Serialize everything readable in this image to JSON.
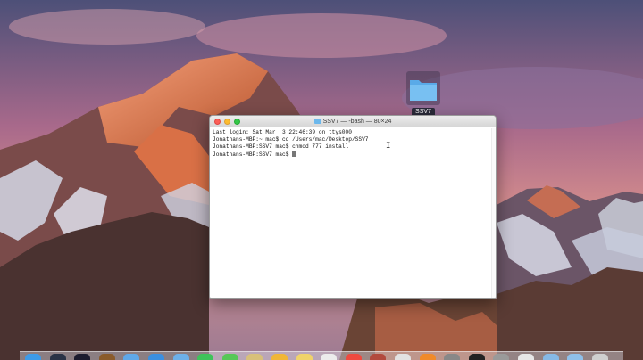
{
  "desktop": {
    "folder_label": "SSV7"
  },
  "terminal": {
    "title": "SSV7 — -bash — 80×24",
    "lines": [
      "Last login: Sat Mar  3 22:46:39 on ttys000",
      "Jonathans-MBP:~ mac$ cd /Users/mac/Desktop/SSV7",
      "Jonathans-MBP:SSV7 mac$ chmod 777 install",
      "Jonathans-MBP:SSV7 mac$ "
    ]
  },
  "dock": {
    "items": [
      {
        "icon": "finder-icon",
        "color": "#3d9be9"
      },
      {
        "icon": "launchpad-icon",
        "color": "#2a3346"
      },
      {
        "icon": "siri-icon",
        "color": "#1c1c2e"
      },
      {
        "icon": "photo-booth-icon",
        "color": "#8a5b2b"
      },
      {
        "icon": "app-store-icon",
        "color": "#5fa8e8"
      },
      {
        "icon": "safari-icon",
        "color": "#3b8fe0"
      },
      {
        "icon": "mail-icon",
        "color": "#6db0e8"
      },
      {
        "icon": "facetime-icon",
        "color": "#3ec35a"
      },
      {
        "icon": "messages-icon",
        "color": "#57c857"
      },
      {
        "icon": "maps-icon",
        "color": "#d8c07a"
      },
      {
        "icon": "photos-icon",
        "color": "#f1b637"
      },
      {
        "icon": "notes-icon",
        "color": "#f0d36a"
      },
      {
        "icon": "reminders-icon",
        "color": "#ececec"
      },
      {
        "icon": "calendar-icon",
        "color": "#ef4a3f"
      },
      {
        "icon": "photo-viewer-icon",
        "color": "#b24a3d"
      },
      {
        "icon": "itunes-icon",
        "color": "#e2e2e2"
      },
      {
        "icon": "ibooks-icon",
        "color": "#f08a2a"
      },
      {
        "icon": "system-preferences-icon",
        "color": "#888"
      },
      {
        "icon": "terminal-icon",
        "color": "#222"
      },
      {
        "icon": "script-editor-icon",
        "color": "#9a9a9a"
      },
      {
        "icon": "textedit-icon",
        "color": "#e7e7e7"
      },
      {
        "icon": "folder-icon",
        "color": "#86b9e6"
      },
      {
        "icon": "downloads-icon",
        "color": "#8fc0ea"
      },
      {
        "icon": "trash-icon",
        "color": "#cfcfcf"
      }
    ]
  }
}
